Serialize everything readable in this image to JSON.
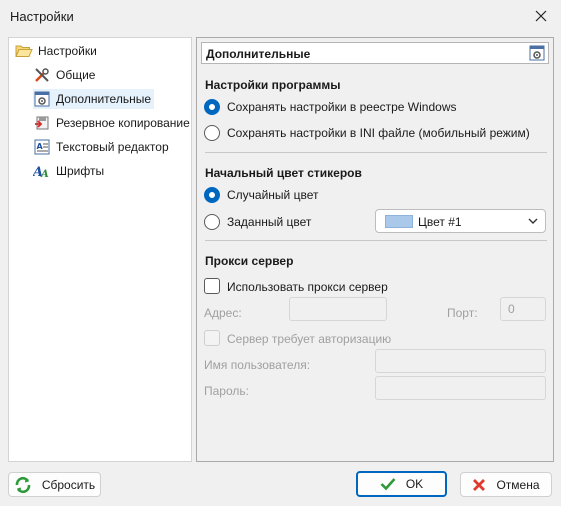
{
  "window": {
    "title": "Настройки"
  },
  "tree": {
    "root_label": "Настройки",
    "items": [
      {
        "label": "Общие"
      },
      {
        "label": "Дополнительные"
      },
      {
        "label": "Резервное копирование"
      },
      {
        "label": "Текстовый редактор"
      },
      {
        "label": "Шрифты"
      }
    ]
  },
  "panel": {
    "header_title": "Дополнительные",
    "program_settings": {
      "title": "Настройки программы",
      "options": [
        {
          "label": "Сохранять настройки в реестре Windows",
          "checked": true
        },
        {
          "label": "Сохранять настройки в INI файле (мобильный режим)",
          "checked": false
        }
      ]
    },
    "sticker_color": {
      "title": "Начальный цвет стикеров",
      "options": [
        {
          "label": "Случайный цвет",
          "checked": true
        },
        {
          "label": "Заданный цвет",
          "checked": false
        }
      ],
      "selected_color_label": "Цвет #1",
      "selected_color_hex": "#a9c8ea"
    },
    "proxy": {
      "title": "Прокси сервер",
      "use_proxy_label": "Использовать прокси сервер",
      "use_proxy_checked": false,
      "address_label": "Адрес:",
      "address_value": "",
      "port_label": "Порт:",
      "port_value": "0",
      "auth_label": "Сервер требует авторизацию",
      "username_label": "Имя пользователя:",
      "username_value": "",
      "password_label": "Пароль:",
      "password_value": ""
    }
  },
  "buttons": {
    "reset": "Сбросить",
    "ok": "OK",
    "cancel": "Отмена"
  },
  "colors": {
    "accent": "#0067c0",
    "selection": "#e5f1fb"
  }
}
